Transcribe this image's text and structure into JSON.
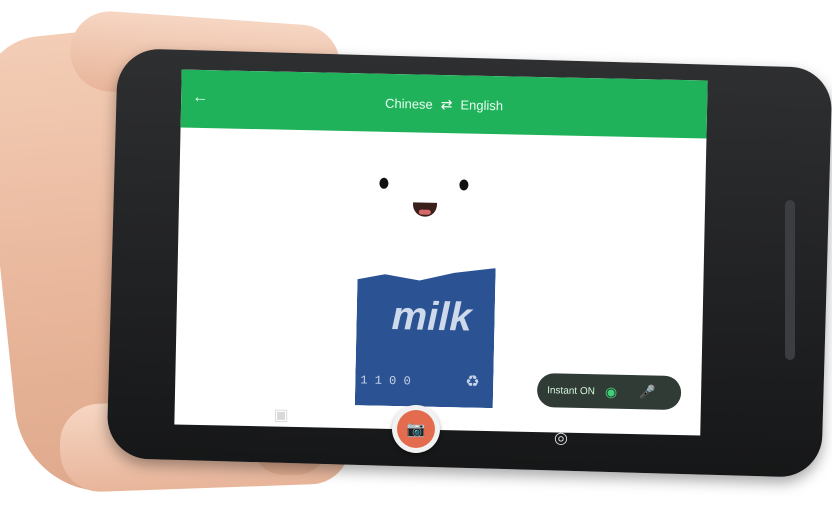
{
  "app": {
    "source_language": "Chinese",
    "target_language": "English",
    "swap_icon": "swap-arrows-icon",
    "back_icon": "arrow-back-icon"
  },
  "scene": {
    "product_text": "milk",
    "barcode_text": "1 1 0 0",
    "recycle_icon": "recycle-icon"
  },
  "instant_toggle": {
    "label": "Instant ON",
    "eye_icon": "eye-icon",
    "mic_icon": "mic-icon"
  },
  "navigation": {
    "left_icon": "gallery-icon",
    "center_icon": "camera-icon",
    "right_icon": "settings-icon"
  },
  "colors": {
    "appbar": "#1fb25a",
    "carton": "#2b5393",
    "camera_button": "#e36b4e"
  }
}
